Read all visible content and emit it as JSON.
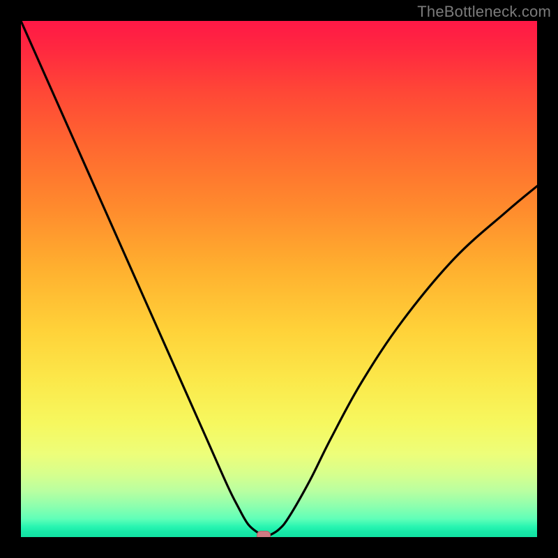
{
  "watermark": "TheBottleneck.com",
  "chart_data": {
    "type": "line",
    "title": "",
    "xlabel": "",
    "ylabel": "",
    "xlim": [
      0,
      100
    ],
    "ylim": [
      0,
      100
    ],
    "grid": false,
    "legend": false,
    "background_gradient": {
      "direction": "vertical",
      "stops": [
        {
          "pos": 0,
          "color": "#ff1846"
        },
        {
          "pos": 0.35,
          "color": "#ff8a2d"
        },
        {
          "pos": 0.7,
          "color": "#fbe94b"
        },
        {
          "pos": 0.92,
          "color": "#baffa0"
        },
        {
          "pos": 1.0,
          "color": "#12e2a3"
        }
      ]
    },
    "series": [
      {
        "name": "bottleneck-curve",
        "x": [
          0,
          4,
          8,
          12,
          16,
          20,
          24,
          28,
          32,
          36,
          40,
          42,
          44,
          46,
          47,
          48,
          50,
          52,
          56,
          60,
          66,
          74,
          84,
          94,
          100
        ],
        "y": [
          100,
          91,
          82,
          73,
          64,
          55,
          46,
          37,
          28,
          19,
          10,
          6,
          2.5,
          0.8,
          0.3,
          0.3,
          1.5,
          4,
          11,
          19,
          30,
          42,
          54,
          63,
          68
        ]
      }
    ],
    "marker": {
      "x": 47,
      "y": 0.3,
      "color": "#cf7a83"
    }
  }
}
